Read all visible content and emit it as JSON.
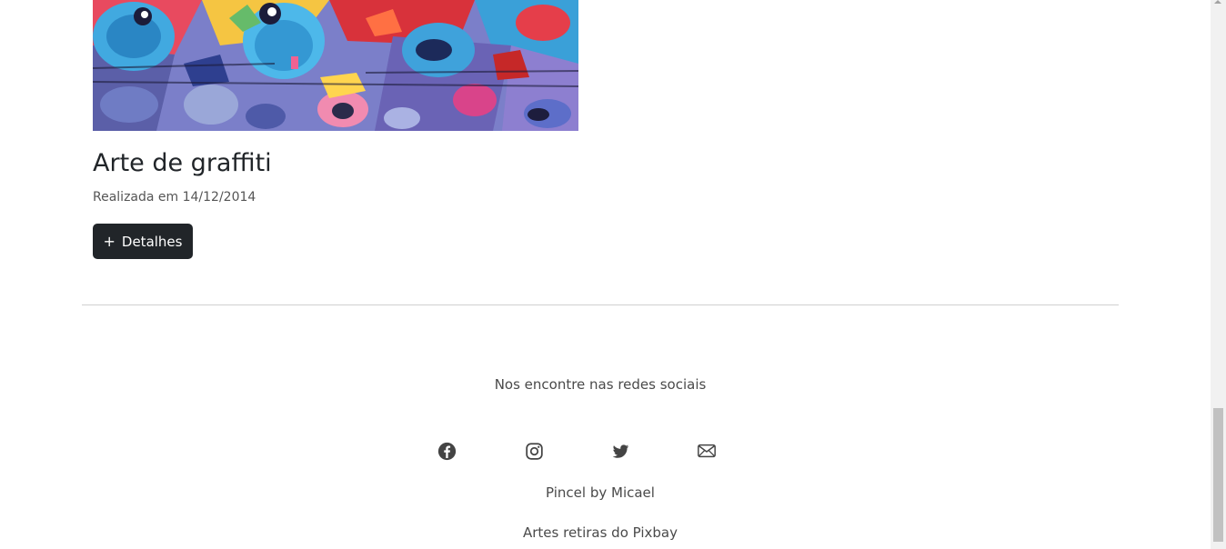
{
  "artwork": {
    "title": "Arte de graffiti",
    "date": "Realizada em 14/12/2014",
    "details_button": "Detalhes",
    "details_icon": "plus-icon"
  },
  "footer": {
    "heading": "Nos encontre nas redes sociais",
    "social_icons": [
      "facebook-icon",
      "instagram-icon",
      "twitter-icon",
      "envelope-icon"
    ],
    "credit": "Pincel by Micael",
    "source": "Artes retiras do Pixbay"
  },
  "colors": {
    "button_bg": "#212529",
    "text": "#212529",
    "muted_text": "#4a4a4a",
    "icon": "#444444"
  }
}
